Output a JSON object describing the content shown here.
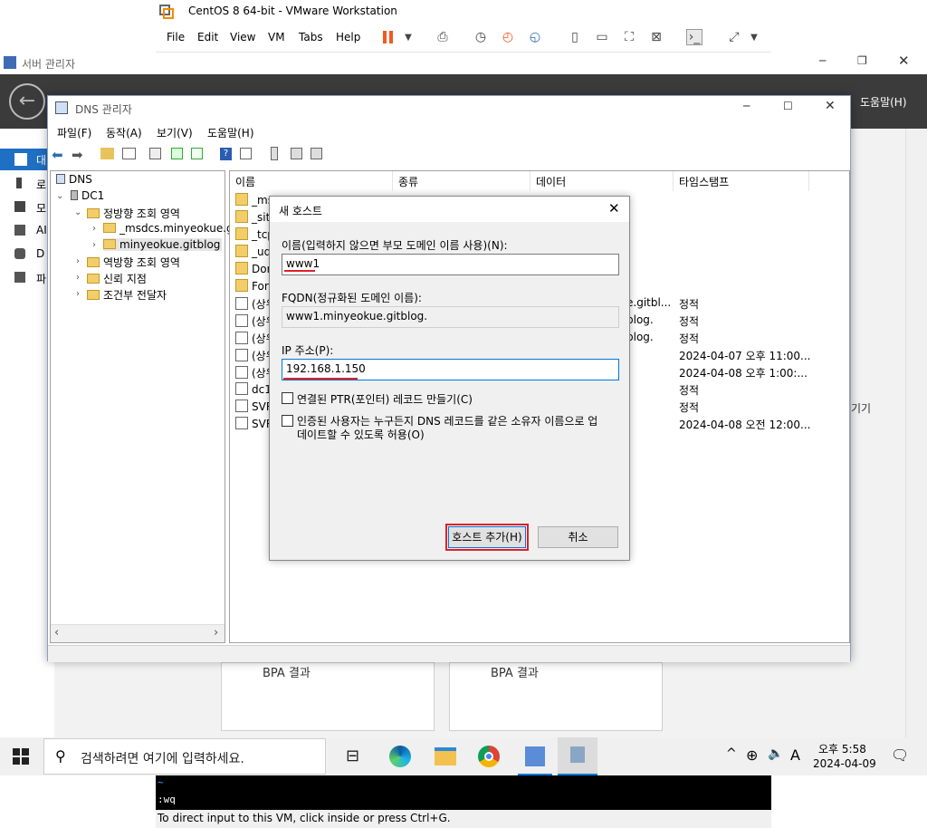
{
  "vmware": {
    "title": "CentOS 8 64-bit - VMware Workstation",
    "menu": [
      "File",
      "Edit",
      "View",
      "VM",
      "Tabs",
      "Help"
    ],
    "accent_color": "#f15a22"
  },
  "server_manager": {
    "title": "서버 관리자",
    "help_label": "도움말(H)",
    "side_items": [
      "대",
      "로",
      "모",
      "AI",
      "D",
      "파"
    ],
    "manage_partial": "기기",
    "bpa_labels": [
      "BPA 결과",
      "BPA 결과"
    ]
  },
  "dns": {
    "title": "DNS 관리자",
    "menu": [
      "파일(F)",
      "동작(A)",
      "보기(V)",
      "도움말(H)"
    ],
    "tree": {
      "root": "DNS",
      "server": "DC1",
      "forward": "정방향 조회 영역",
      "msdcs": "_msdcs.minyeokue.g",
      "zone": "minyeokue.gitblog",
      "reverse": "역방향 조회 영역",
      "trust": "신뢰 지점",
      "conditional": "조건부 전달자"
    },
    "columns": [
      "이름",
      "종류",
      "데이터",
      "타임스탬프"
    ],
    "rows": [
      {
        "name": "_ms",
        "data": "",
        "time": ""
      },
      {
        "name": "_site",
        "data": "",
        "time": ""
      },
      {
        "name": "_tcp",
        "data": "",
        "time": ""
      },
      {
        "name": "_udp",
        "data": "",
        "time": ""
      },
      {
        "name": "Dom",
        "data": "",
        "time": ""
      },
      {
        "name": "Fore",
        "data": "",
        "time": ""
      },
      {
        "name": "(상위",
        "data": "e.gitbl...",
        "time": "정적"
      },
      {
        "name": "(상위",
        "data": "blog.",
        "time": "정적"
      },
      {
        "name": "(상위",
        "data": "blog.",
        "time": "정적"
      },
      {
        "name": "(상위",
        "data": "",
        "time": "2024-04-07 오후 11:00..."
      },
      {
        "name": "(상위",
        "data": "",
        "time": "2024-04-08 오후 1:00:..."
      },
      {
        "name": "dc1",
        "data": "",
        "time": "정적"
      },
      {
        "name": "SVR",
        "data": "",
        "time": "정적"
      },
      {
        "name": "SVR",
        "data": "",
        "time": "2024-04-08 오전 12:00..."
      }
    ]
  },
  "dialog": {
    "title": "새 호스트",
    "name_label": "이름(입력하지 않으면 부모 도메인 이름 사용)(N):",
    "name_value": "www1",
    "fqdn_label": "FQDN(정규화된 도메인 이름):",
    "fqdn_value": "www1.minyeokue.gitblog.",
    "ip_label": "IP 주소(P):",
    "ip_value": "192.168.1.150",
    "ptr_label": "연결된 PTR(포인터) 레코드 만들기(C)",
    "auth_label_1": "인증된 사용자는 누구든지 DNS 레코드를 같은 소유자 이름으로 업",
    "auth_label_2": "데이트할 수 있도록 허용(O)",
    "add_button": "호스트 추가(H)",
    "cancel_button": "취소",
    "highlight_color": "#e0202a"
  },
  "taskbar": {
    "search_placeholder": "검색하려면 여기에 입력하세요.",
    "time": "오후 5:58",
    "date": "2024-04-09",
    "ime": "A"
  },
  "console": {
    "line1": "~",
    "line2": ":wq"
  },
  "vm_status": "To direct input to this VM, click inside or press Ctrl+G."
}
